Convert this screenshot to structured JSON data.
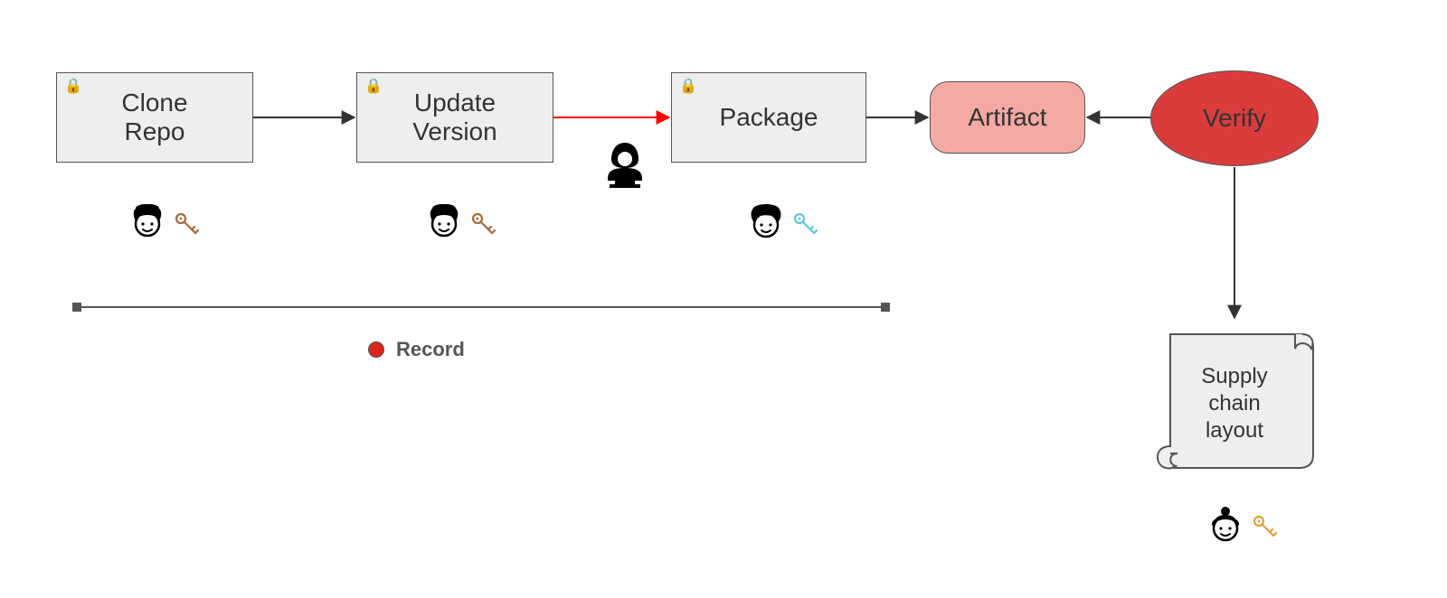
{
  "nodes": {
    "clone": {
      "label": "Clone\nRepo",
      "locked": true
    },
    "update": {
      "label": "Update\nVersion",
      "locked": true
    },
    "package": {
      "label": "Package",
      "locked": true
    },
    "artifact": {
      "label": "Artifact"
    },
    "verify": {
      "label": "Verify"
    },
    "scroll": {
      "label": "Supply\nchain\nlayout"
    }
  },
  "record": {
    "label": "Record"
  },
  "actors": {
    "clone": {
      "key_color": "#a36b3a"
    },
    "update": {
      "key_color": "#a36b3a"
    },
    "package": {
      "key_color": "#5ec8d8"
    },
    "scroll": {
      "key_color": "#e5a13a"
    }
  },
  "edges": {
    "clone_to_update": {
      "color": "#333333"
    },
    "update_to_package": {
      "color": "#ff0000",
      "compromised": true
    },
    "package_to_artifact": {
      "color": "#333333"
    },
    "verify_to_artifact": {
      "color": "#333333"
    },
    "verify_to_scroll": {
      "color": "#333333"
    }
  },
  "colors": {
    "box_fill": "#eeeeee",
    "box_stroke": "#555555",
    "artifact_fill": "#f4a9a4",
    "verify_fill": "#da3c3c",
    "record_dot": "#d9261c"
  }
}
